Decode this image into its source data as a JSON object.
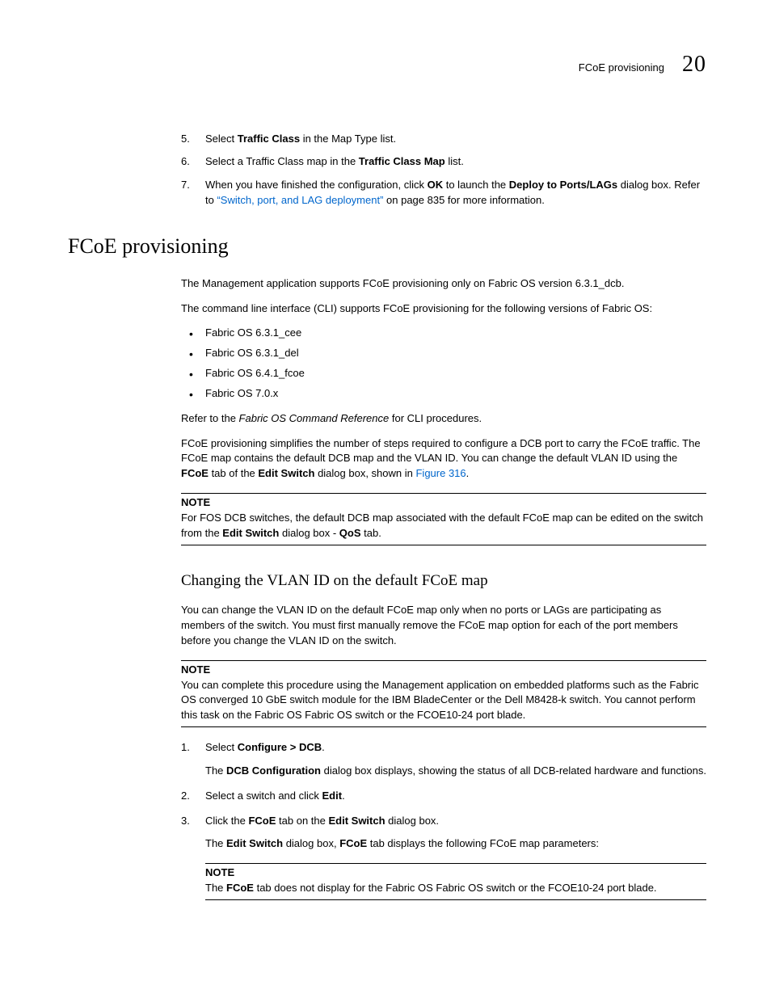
{
  "header": {
    "running": "FCoE provisioning",
    "chapter": "20"
  },
  "steps": {
    "s5a": "Select ",
    "s5b": "Traffic Class",
    "s5c": " in the Map Type list.",
    "s6a": "Select a Traffic Class map in the ",
    "s6b": "Traffic Class Map",
    "s6c": " list.",
    "s7a": "When you have finished the configuration, click ",
    "s7b": "OK",
    "s7c": " to launch the ",
    "s7d": "Deploy to Ports/LAGs",
    "s7e": " dialog box. Refer to ",
    "s7f": "“Switch, port, and LAG deployment”",
    "s7g": " on page 835 for more information."
  },
  "h1": "FCoE provisioning",
  "intro1": "The Management application supports FCoE provisioning only on Fabric OS version 6.3.1_dcb.",
  "intro2": "The command line interface (CLI) supports FCoE provisioning for the following versions of Fabric OS:",
  "versions": {
    "v1": "Fabric OS 6.3.1_cee",
    "v2": "Fabric OS 6.3.1_del",
    "v3": "Fabric OS 6.4.1_fcoe",
    "v4": "Fabric OS 7.0.x"
  },
  "ref": {
    "a": "Refer to the ",
    "b": "Fabric OS Command Reference",
    "c": " for CLI procedures."
  },
  "para3": {
    "a": "FCoE provisioning simplifies the number of steps required to configure a DCB port to carry the FCoE traffic. The FCoE map contains the default DCB map and the VLAN ID. You can change the default VLAN ID using the ",
    "b": "FCoE",
    "c": " tab of the ",
    "d": "Edit Switch",
    "e": " dialog box, shown in ",
    "f": "Figure 316",
    "g": "."
  },
  "noteLabel": "NOTE",
  "note1": {
    "a": "For FOS DCB switches, the default DCB map associated with the default FCoE map can be edited on the switch from the ",
    "b": "Edit Switch",
    "c": " dialog box - ",
    "d": "QoS",
    "e": " tab."
  },
  "h2": "Changing the VLAN ID on the default FCoE map",
  "chg1": "You can change the VLAN ID on the default FCoE map only when no ports or LAGs are participating as members of the switch. You must first manually remove the FCoE map option for each of the port members before you change the VLAN ID on the switch.",
  "note2": "You can complete this procedure using the Management application on embedded platforms such as the Fabric OS converged 10 GbE switch module for the IBM BladeCenter or the Dell M8428-k switch. You cannot perform this task on the Fabric OS Fabric OS switch or the FCOE10-24 port blade.",
  "proc": {
    "p1a": "Select ",
    "p1b": "Configure > DCB",
    "p1c": ".",
    "p1s": {
      "a": "The ",
      "b": "DCB Configuration",
      "c": " dialog box displays, showing the status of all DCB-related hardware and functions."
    },
    "p2a": "Select a switch and click ",
    "p2b": "Edit",
    "p2c": ".",
    "p3a": "Click the ",
    "p3b": "FCoE",
    "p3c": " tab on the ",
    "p3d": "Edit Switch",
    "p3e": " dialog box.",
    "p3s": {
      "a": "The ",
      "b": "Edit Switch",
      "c": " dialog box, ",
      "d": "FCoE",
      "e": " tab displays the following FCoE map parameters:"
    }
  },
  "note3": {
    "a": "The ",
    "b": "FCoE",
    "c": " tab does not display for the Fabric OS Fabric OS switch or the FCOE10-24 port blade."
  }
}
